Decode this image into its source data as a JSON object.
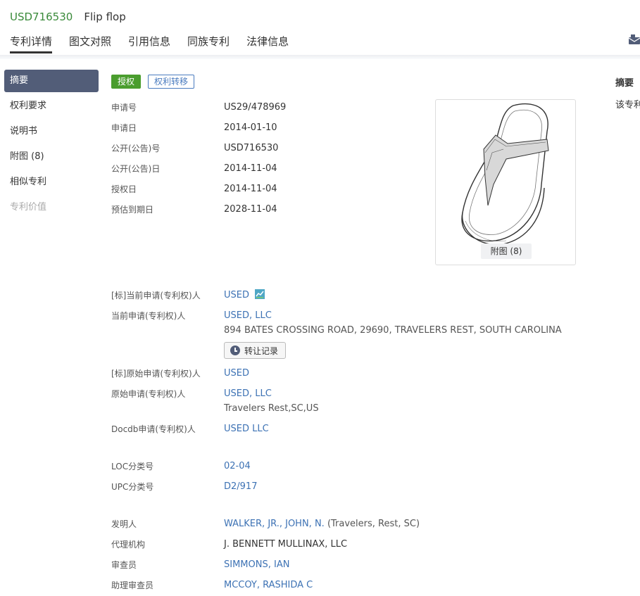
{
  "header": {
    "patent_number": "USD716530",
    "patent_title": "Flip flop",
    "tabs": [
      "专利详情",
      "图文对照",
      "引用信息",
      "同族专利",
      "法律信息"
    ]
  },
  "sidebar": {
    "items": [
      {
        "label": "摘要",
        "state": "active"
      },
      {
        "label": "权利要求",
        "state": "normal"
      },
      {
        "label": "说明书",
        "state": "normal"
      },
      {
        "label": "附图 (8)",
        "state": "normal"
      },
      {
        "label": "相似专利",
        "state": "normal"
      },
      {
        "label": "专利价值",
        "state": "disabled"
      }
    ]
  },
  "badges": {
    "status": "授权",
    "transfer": "权利转移"
  },
  "basic_info": {
    "application_no": {
      "label": "申请号",
      "value": "US29/478969"
    },
    "application_date": {
      "label": "申请日",
      "value": "2014-01-10"
    },
    "publication_no": {
      "label": "公开(公告)号",
      "value": "USD716530"
    },
    "publication_date": {
      "label": "公开(公告)日",
      "value": "2014-11-04"
    },
    "grant_date": {
      "label": "授权日",
      "value": "2014-11-04"
    },
    "expiry_date": {
      "label": "预估到期日",
      "value": "2028-11-04"
    }
  },
  "figure": {
    "caption": "附图 (8)"
  },
  "applicants": {
    "std_current": {
      "label": "[标]当前申请(专利权)人",
      "value": "USED"
    },
    "current": {
      "label": "当前申请(专利权)人",
      "value": "USED, LLC",
      "address": "894 BATES CROSSING ROAD, 29690, TRAVELERS REST, SOUTH CAROLINA"
    },
    "history_button": "转让记录",
    "std_original": {
      "label": "[标]原始申请(专利权)人",
      "value": "USED"
    },
    "original": {
      "label": "原始申请(专利权)人",
      "value": "USED, LLC",
      "address": "Travelers Rest,SC,US"
    },
    "docdb": {
      "label": "Docdb申请(专利权)人",
      "value": "USED LLC"
    }
  },
  "classification": {
    "loc": {
      "label": "LOC分类号",
      "value": "02-04"
    },
    "upc": {
      "label": "UPC分类号",
      "value": "D2/917"
    }
  },
  "people": {
    "inventor": {
      "label": "发明人",
      "value": "WALKER, JR., JOHN, N.",
      "location": "(Travelers, Rest, SC)"
    },
    "agency": {
      "label": "代理机构",
      "value": "J. BENNETT MULLINAX, LLC"
    },
    "examiner": {
      "label": "审查员",
      "value": "SIMMONS, IAN"
    },
    "assistant_examiner": {
      "label": "助理审查员",
      "value": "MCCOY, RASHIDA C"
    }
  },
  "right_panel": {
    "title": "摘要",
    "text": "该专利"
  },
  "colors": {
    "patent_number": "#3a8a3a",
    "link": "#3d72b4",
    "granted_badge": "#4a9d2e",
    "active_nav": "#525d78"
  }
}
